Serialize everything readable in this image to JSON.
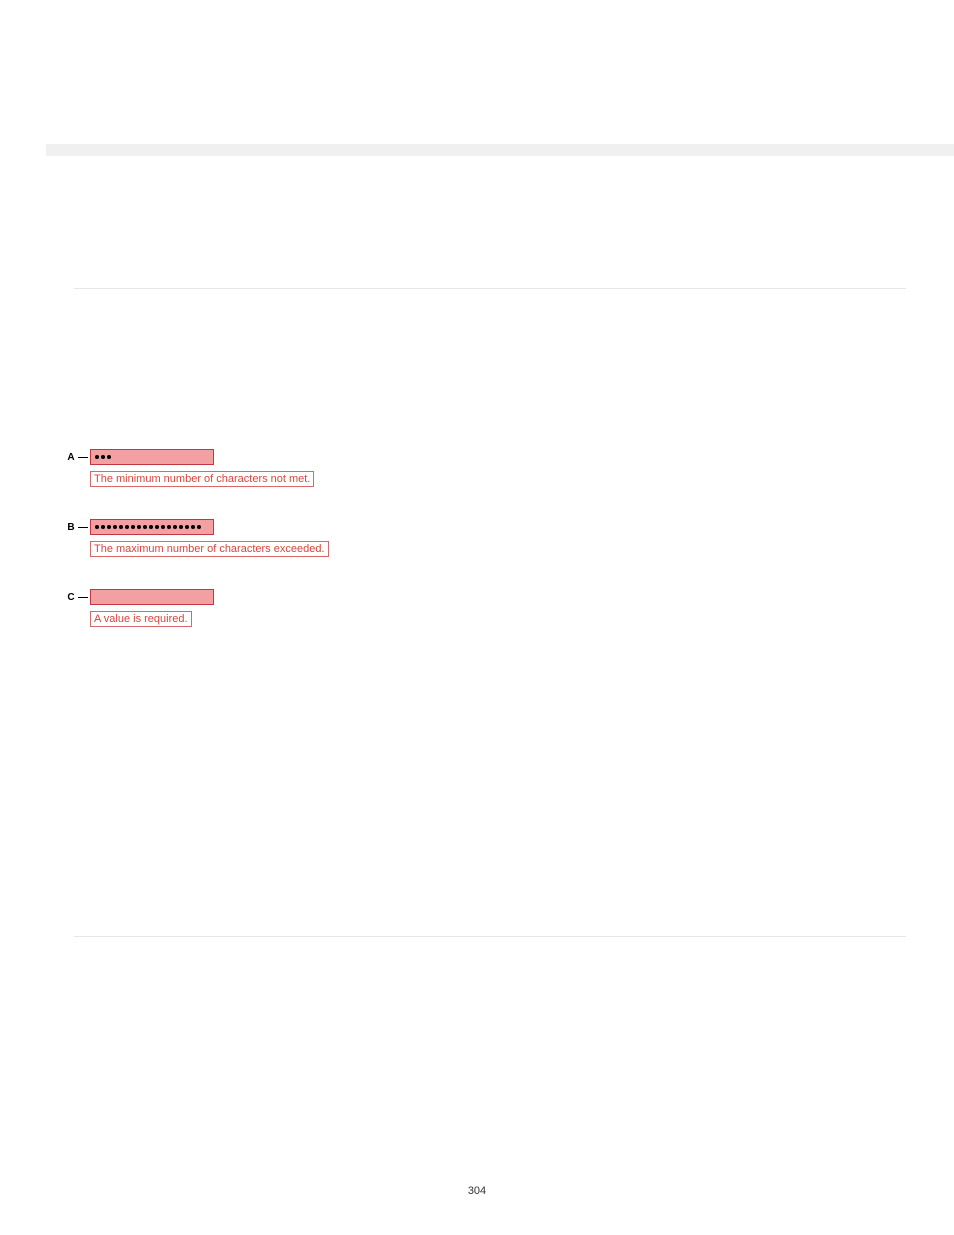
{
  "examples": [
    {
      "marker": "A",
      "dotCount": 3,
      "error": "The minimum number of characters not met."
    },
    {
      "marker": "B",
      "dotCount": 18,
      "error": "The maximum number of characters exceeded."
    },
    {
      "marker": "C",
      "dotCount": 0,
      "error": "A value is required."
    }
  ],
  "pageNumber": "304"
}
